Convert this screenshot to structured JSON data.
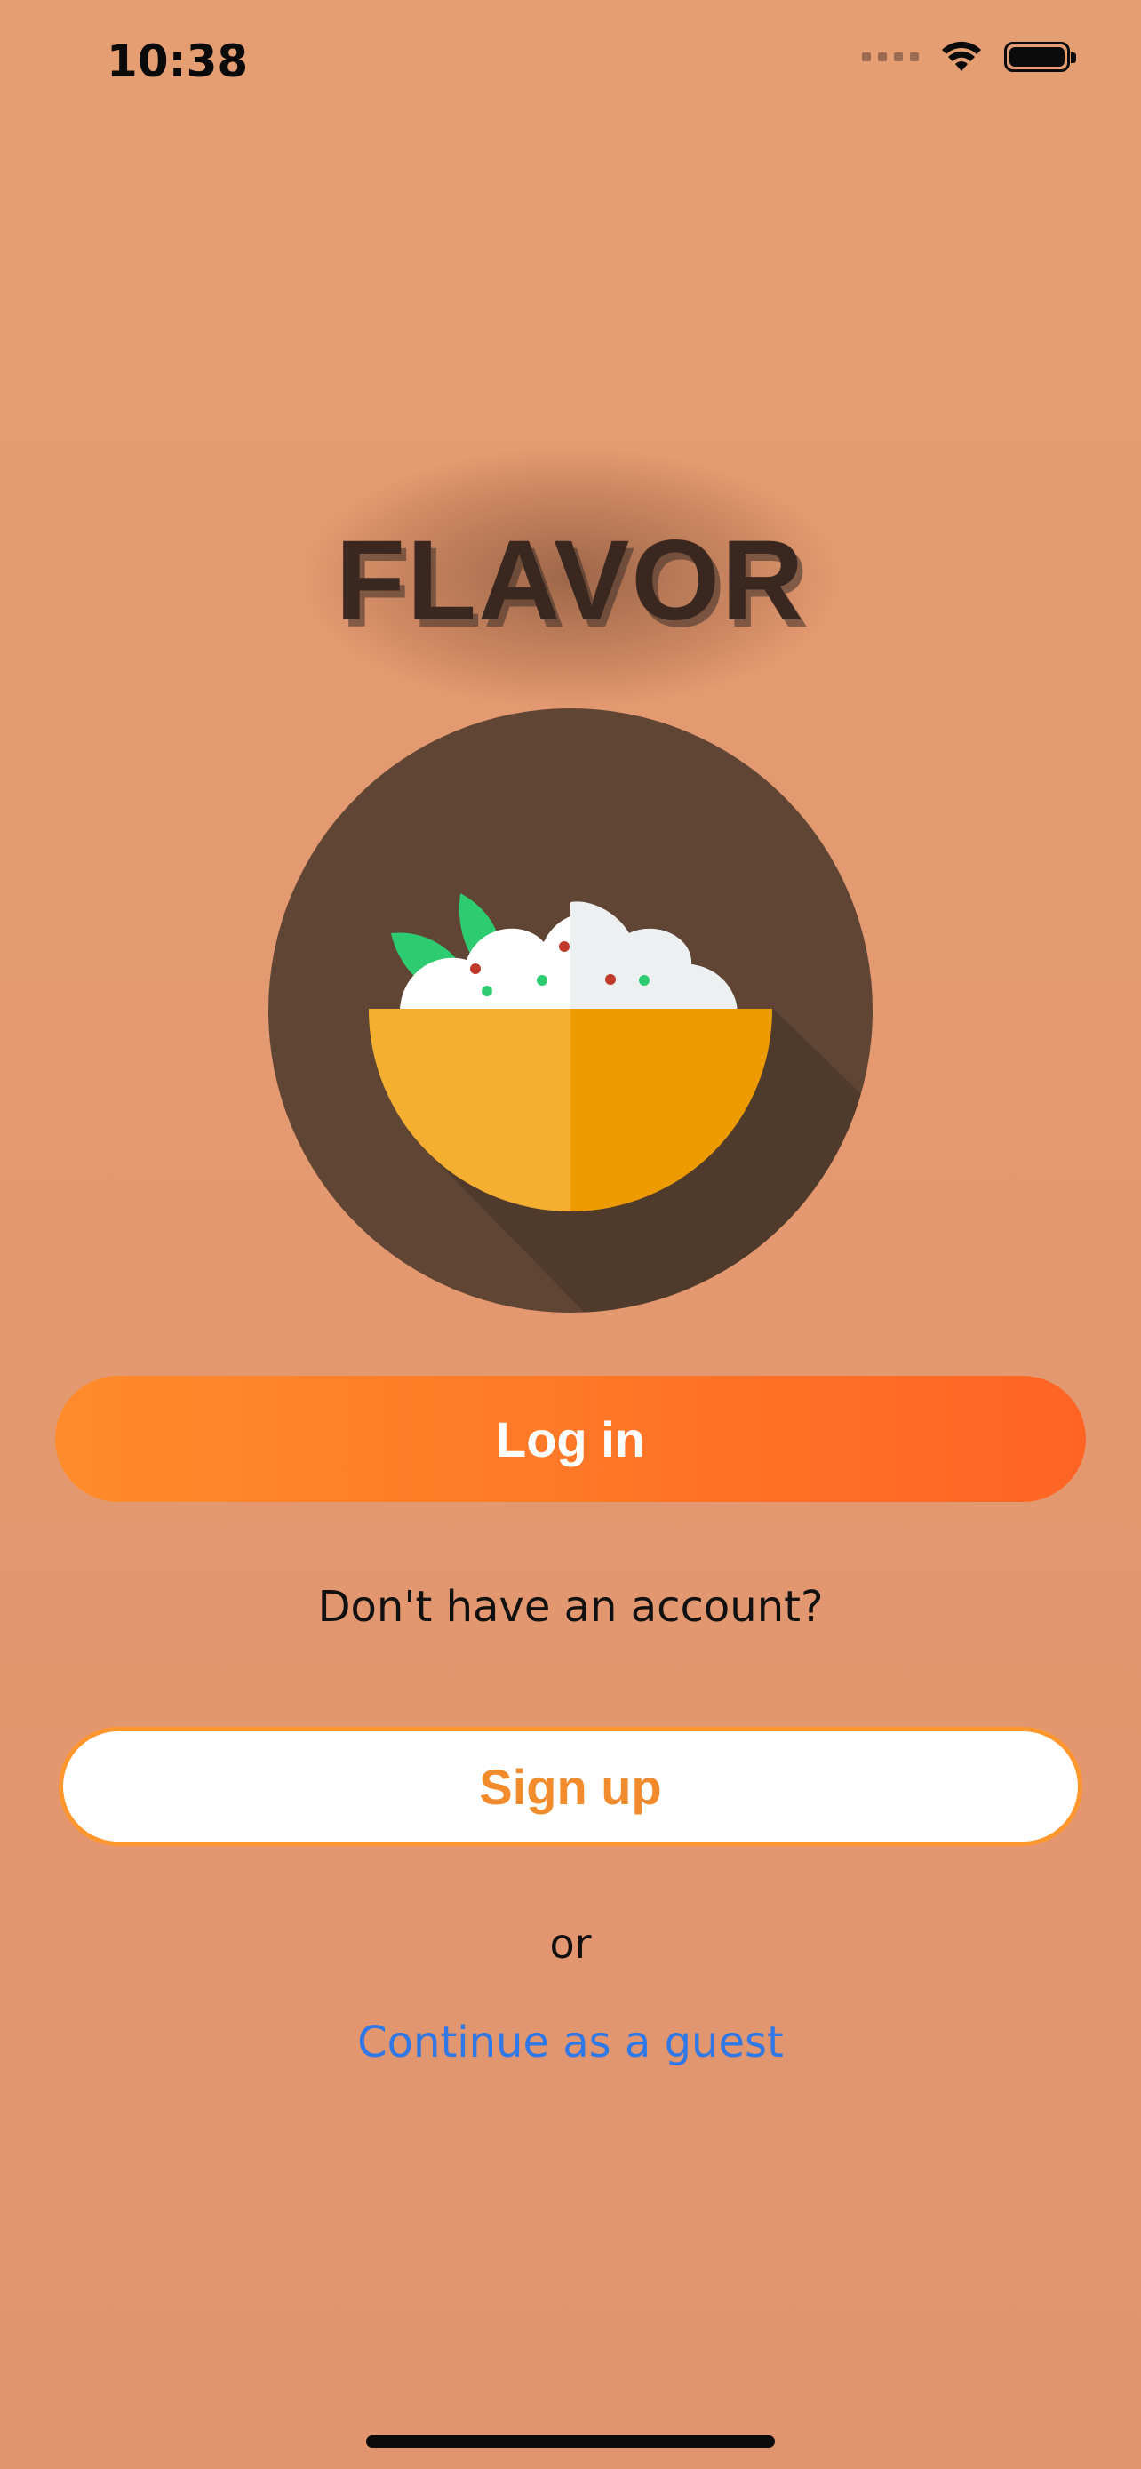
{
  "status_bar": {
    "time": "10:38"
  },
  "app": {
    "title": "FLAVOR"
  },
  "auth": {
    "login_label": "Log in",
    "no_account_text": "Don't have an account?",
    "signup_label": "Sign up",
    "or_text": "or",
    "guest_label": "Continue as a guest"
  },
  "icons": {
    "wifi": "wifi-icon",
    "battery": "battery-icon",
    "signal": "signal-icon",
    "logo": "rice-bowl-icon"
  },
  "colors": {
    "background": "#e3986f",
    "login_gradient_start": "#ff8c2b",
    "login_gradient_end": "#ff6424",
    "signup_text": "#f28b2c",
    "signup_border": "#ff962e",
    "guest_link": "#2f78e6",
    "title": "#3a2820"
  }
}
